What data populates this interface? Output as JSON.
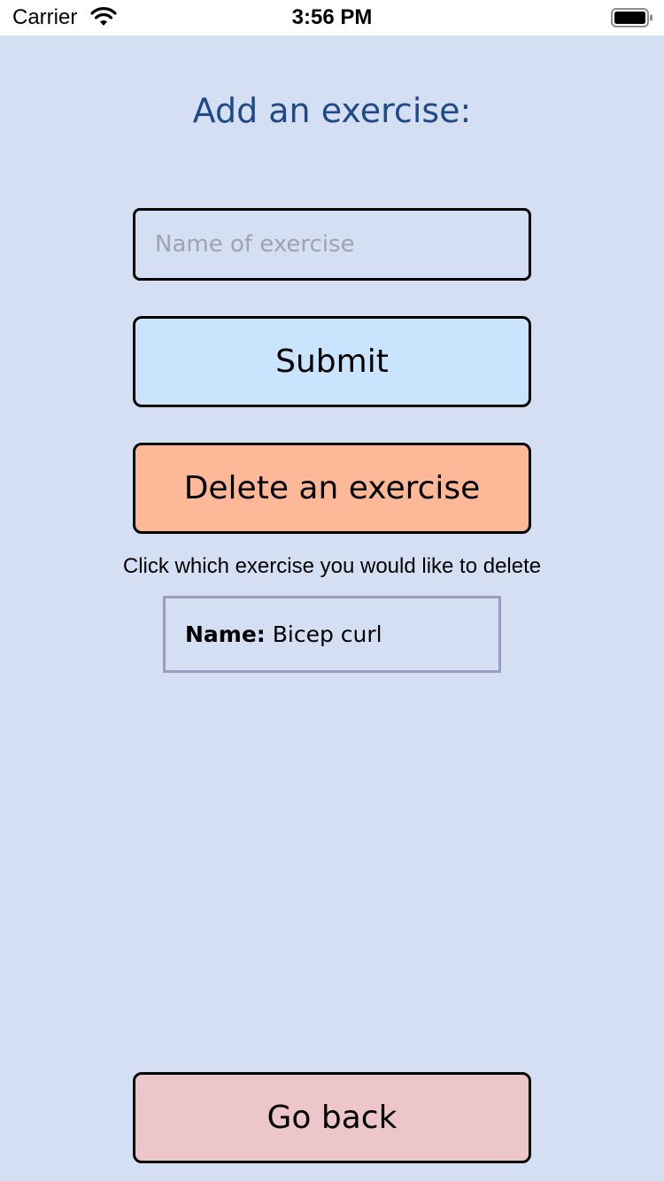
{
  "status_bar": {
    "carrier": "Carrier",
    "time": "3:56 PM",
    "wifi_icon": "wifi-icon",
    "battery_icon": "battery-icon"
  },
  "page": {
    "title": "Add an exercise:"
  },
  "form": {
    "name_placeholder": "Name of exercise",
    "name_value": "",
    "submit_label": "Submit",
    "delete_label": "Delete an exercise"
  },
  "delete_section": {
    "instruction": "Click which exercise you would like to delete",
    "items": [
      {
        "label": "Name:",
        "value": "Bicep curl"
      }
    ]
  },
  "navigation": {
    "back_label": "Go back"
  },
  "colors": {
    "background": "#d5dff3",
    "title": "#1f4a86",
    "submit": "#cbe4fe",
    "delete": "#fdb898",
    "back": "#ecc6c8",
    "item_border": "#9a9cc2"
  }
}
